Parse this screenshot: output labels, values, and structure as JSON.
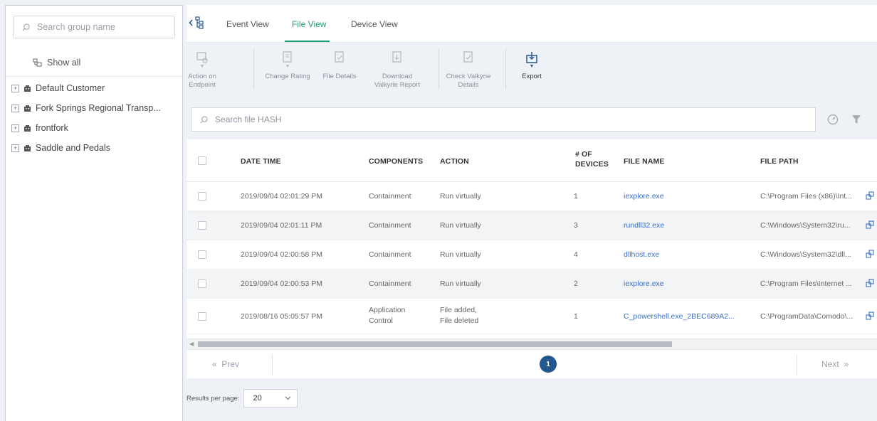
{
  "sidebar": {
    "search_placeholder": "Search group name",
    "show_all": "Show all",
    "groups": [
      {
        "label": "Default Customer"
      },
      {
        "label": "Fork Springs Regional Transp..."
      },
      {
        "label": "frontfork"
      },
      {
        "label": "Saddle and Pedals"
      }
    ]
  },
  "tabs": {
    "items": [
      "Event View",
      "File View",
      "Device View"
    ],
    "active": "File View"
  },
  "toolbar": {
    "action_on_endpoint": [
      "Action on",
      "Endpoint"
    ],
    "change_rating": "Change Rating",
    "file_details": "File Details",
    "download_valkyrie": [
      "Download",
      "Valkyrie Report"
    ],
    "check_valkyrie": [
      "Check Valkyrie",
      "Details"
    ],
    "export": "Export"
  },
  "file_search": {
    "placeholder": "Search file HASH"
  },
  "table": {
    "headers": {
      "datetime": "DATE TIME",
      "components": "COMPONENTS",
      "action": "ACTION",
      "devices_line1": "# OF",
      "devices_line2": "DEVICES",
      "filename": "FILE NAME",
      "filepath": "FILE PATH"
    },
    "rows": [
      {
        "datetime": "2019/09/04 02:01:29 PM",
        "components": [
          "Containment"
        ],
        "action": [
          "Run virtually"
        ],
        "devices": "1",
        "filename": "iexplore.exe",
        "filepath": "C:\\Program Files (x86)\\Int..."
      },
      {
        "datetime": "2019/09/04 02:01:11 PM",
        "components": [
          "Containment"
        ],
        "action": [
          "Run virtually"
        ],
        "devices": "3",
        "filename": "rundll32.exe",
        "filepath": "C:\\Windows\\System32\\ru..."
      },
      {
        "datetime": "2019/09/04 02:00:58 PM",
        "components": [
          "Containment"
        ],
        "action": [
          "Run virtually"
        ],
        "devices": "4",
        "filename": "dllhost.exe",
        "filepath": "C:\\Windows\\System32\\dll..."
      },
      {
        "datetime": "2019/09/04 02:00:53 PM",
        "components": [
          "Containment"
        ],
        "action": [
          "Run virtually"
        ],
        "devices": "2",
        "filename": "iexplore.exe",
        "filepath": "C:\\Program Files\\Internet ..."
      },
      {
        "datetime": "2019/08/16 05:05:57 PM",
        "components": [
          "Application",
          "Control"
        ],
        "action": [
          "File added,",
          "File deleted"
        ],
        "devices": "1",
        "filename": "C_powershell.exe_2BEC689A2...",
        "filepath": "C:\\ProgramData\\Comodo\\..."
      }
    ]
  },
  "pagination": {
    "prev": "Prev",
    "current_page": "1",
    "next": "Next"
  },
  "results_per_page": {
    "label": "Results per page:",
    "value": "20"
  },
  "colors": {
    "accent_green": "#1a9c78",
    "page_badge": "#23578f",
    "link_blue": "#3b6fc4"
  }
}
